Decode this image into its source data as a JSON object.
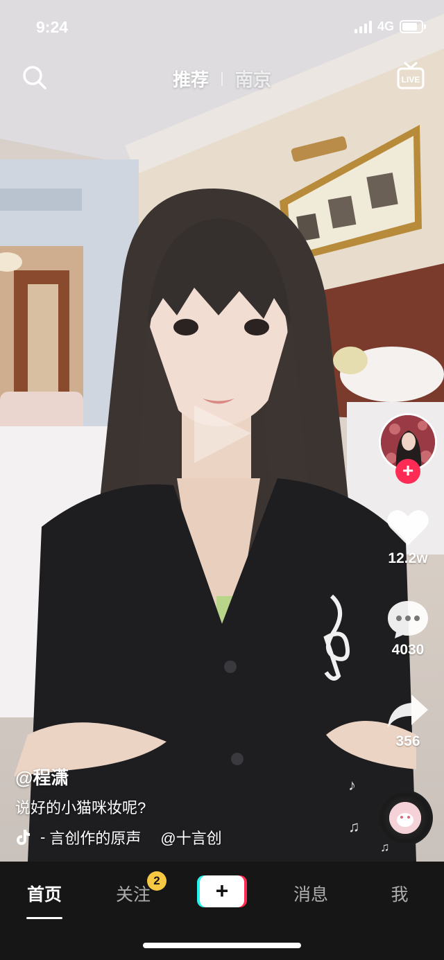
{
  "status_bar": {
    "time": "9:24",
    "network": "4G"
  },
  "top_nav": {
    "tabs": [
      {
        "label": "推荐",
        "active": true
      },
      {
        "label": "南京",
        "active": false
      }
    ],
    "search_icon": "search-icon",
    "live_icon": "live-tv-icon",
    "live_label": "LIVE"
  },
  "actions": {
    "follow_symbol": "+",
    "likes": "12.2w",
    "comments": "4030",
    "shares": "356"
  },
  "caption": {
    "username": "@程潇",
    "description": "说好的小猫咪妆呢?",
    "music_text": "言创作的原声",
    "music_author": "@十言创"
  },
  "tabbar": {
    "items": [
      {
        "label": "首页",
        "active": true
      },
      {
        "label": "关注",
        "active": false
      },
      {
        "label": "+",
        "active": false
      },
      {
        "label": "消息",
        "active": false
      },
      {
        "label": "我",
        "active": false
      }
    ],
    "follow_badge": "2"
  },
  "colors": {
    "accent": "#fe2c55",
    "cyan": "#25f4ee",
    "badge": "#f7c843",
    "tabbar_bg": "#161616"
  }
}
